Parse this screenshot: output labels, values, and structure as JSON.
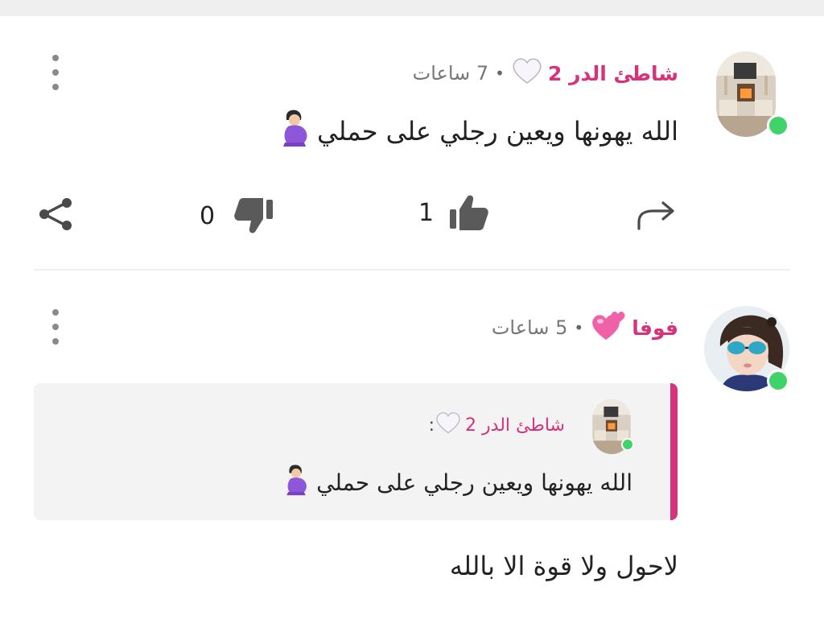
{
  "colors": {
    "accent": "#d6337c",
    "online": "#3fd36a",
    "muted": "#777777"
  },
  "comments": [
    {
      "author": "شاطئ الدر 2",
      "author_emoji": "🤍",
      "separator": "•",
      "time": "7 ساعات",
      "text": "الله يهونها ويعين رجلي على حملي",
      "text_emoji": "🤰",
      "likes": "1",
      "dislikes": "0",
      "reply_icon": "reply-arrow-icon",
      "like_icon": "thumbs-up-icon",
      "dislike_icon": "thumbs-down-icon",
      "share_icon": "share-icon",
      "menu_icon": "kebab-menu-icon"
    },
    {
      "author": "فوفا",
      "author_emoji": "💞",
      "separator": "•",
      "time": "5 ساعات",
      "quote": {
        "author": "شاطئ الدر 2",
        "author_emoji": "🤍",
        "suffix": ":",
        "text": "الله يهونها ويعين رجلي على حملي",
        "text_emoji": "🤰"
      },
      "text": "لاحول ولا قوة الا بالله",
      "menu_icon": "kebab-menu-icon"
    }
  ]
}
